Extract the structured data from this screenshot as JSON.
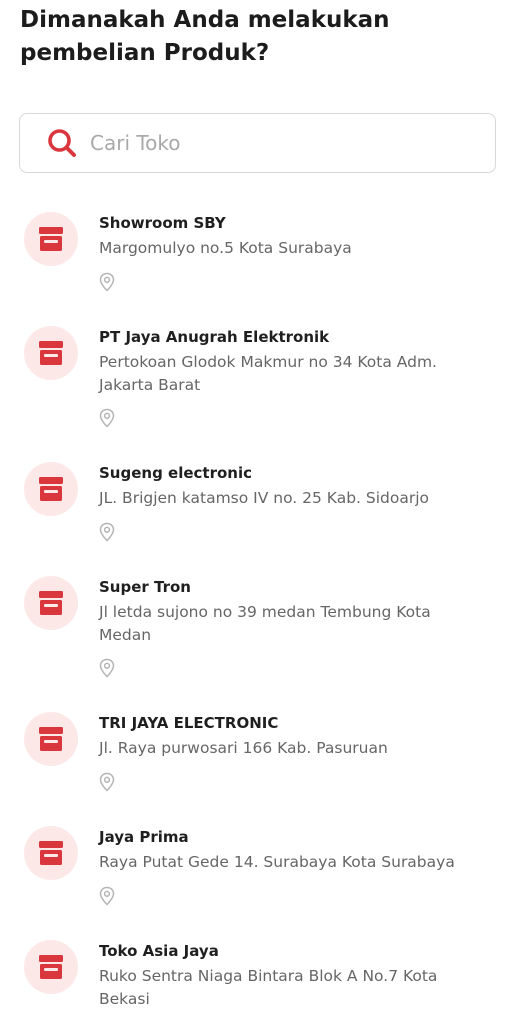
{
  "header": {
    "title": "Dimanakah Anda melakukan pembelian Produk?"
  },
  "search": {
    "placeholder": "Cari Toko",
    "value": "",
    "icon": "search-icon"
  },
  "colors": {
    "accent": "#d9363e",
    "badge_bg": "#fde8e8",
    "pin_gray": "#b5b5b5"
  },
  "stores": [
    {
      "name": "Showroom SBY",
      "address": "Margomulyo no.5 Kota Surabaya",
      "icon": "store-icon"
    },
    {
      "name": "PT Jaya Anugrah Elektronik",
      "address": "Pertokoan Glodok Makmur no 34 Kota Adm. Jakarta Barat",
      "icon": "store-icon"
    },
    {
      "name": "Sugeng electronic",
      "address": "JL. Brigjen katamso IV no. 25 Kab. Sidoarjo",
      "icon": "store-icon"
    },
    {
      "name": "Super Tron",
      "address": "Jl letda sujono no 39 medan Tembung Kota Medan",
      "icon": "store-icon"
    },
    {
      "name": "TRI JAYA ELECTRONIC",
      "address": "Jl. Raya purwosari 166 Kab. Pasuruan",
      "icon": "store-icon"
    },
    {
      "name": "Jaya Prima",
      "address": "Raya Putat Gede 14. Surabaya Kota Surabaya",
      "icon": "store-icon"
    },
    {
      "name": "Toko Asia Jaya",
      "address": "Ruko Sentra Niaga Bintara Blok A No.7 Kota Bekasi",
      "icon": "store-icon"
    }
  ]
}
